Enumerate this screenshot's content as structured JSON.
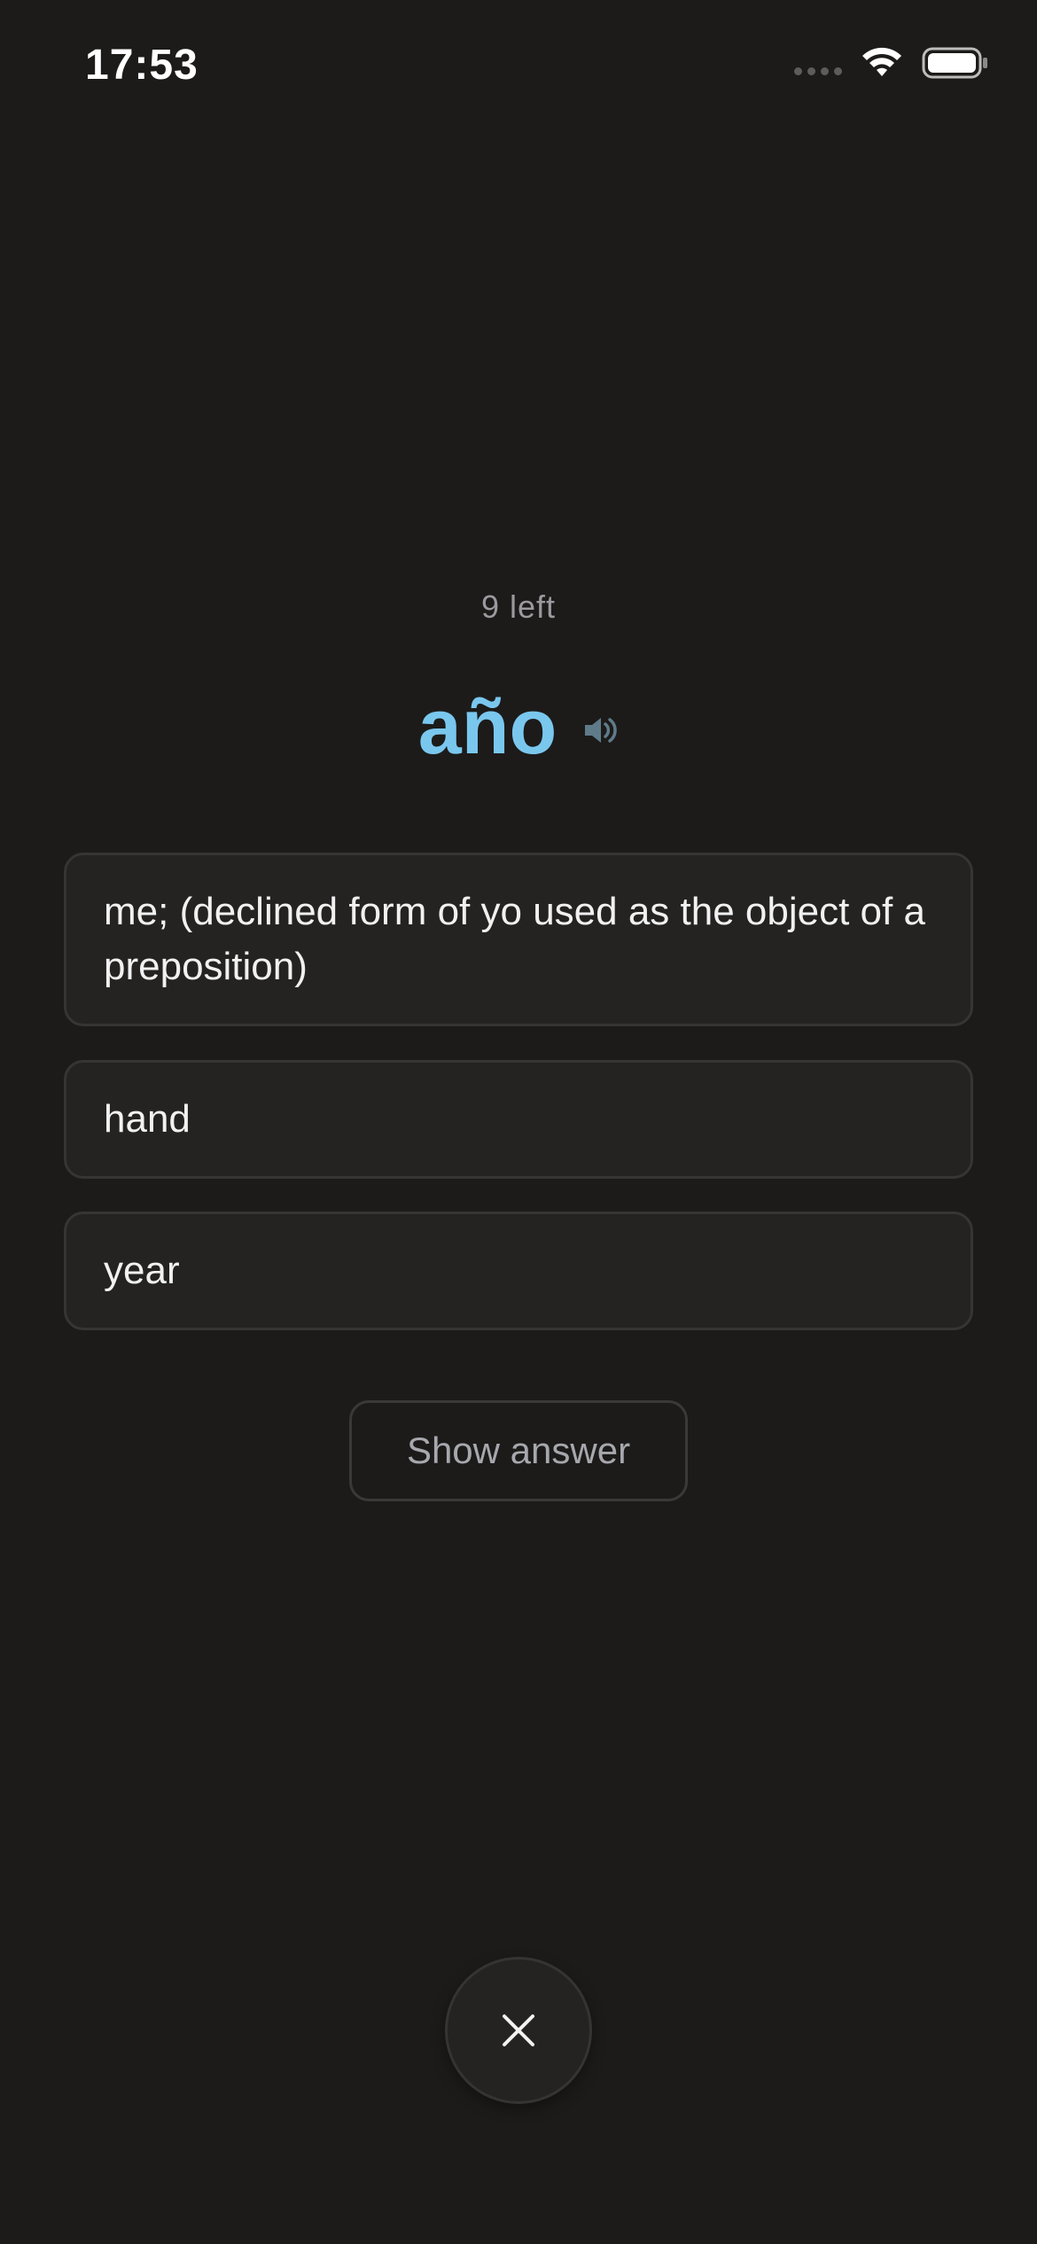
{
  "status_bar": {
    "time": "17:53",
    "icons": [
      "cellular-signal-icon",
      "wifi-icon",
      "battery-icon"
    ]
  },
  "review": {
    "remaining_label": "9 left",
    "word": "año",
    "speaker_icon": "speaker-icon"
  },
  "options": [
    {
      "label": "me; (declined form of yo used as the object of a preposition)"
    },
    {
      "label": "hand"
    },
    {
      "label": "year"
    }
  ],
  "actions": {
    "show_answer_label": "Show answer",
    "close_icon": "close-icon"
  },
  "colors": {
    "background": "#1c1b1a",
    "card": "#242322",
    "accent_word": "#7ac7ee",
    "muted_text": "#9a9a9e"
  }
}
